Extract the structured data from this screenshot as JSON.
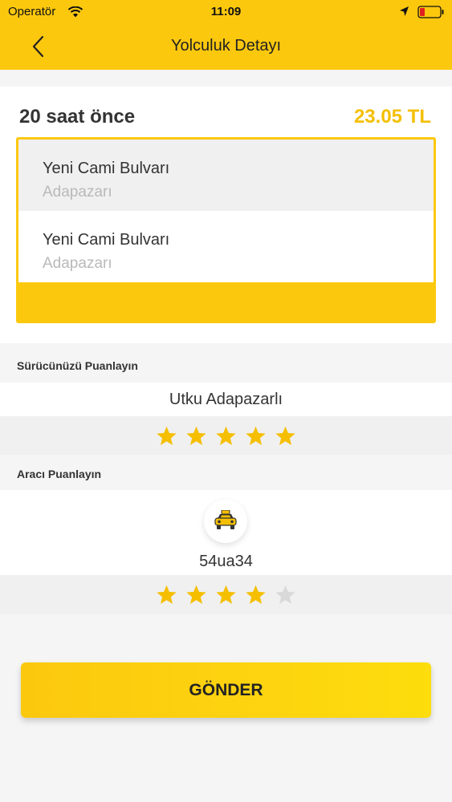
{
  "status_bar": {
    "carrier": "Operatör",
    "time": "11:09"
  },
  "nav": {
    "title": "Yolculuk Detayı"
  },
  "trip": {
    "time_ago": "20 saat önce",
    "price": "23.05 TL",
    "route": [
      {
        "street": "Yeni Cami Bulvarı",
        "city": "Adapazarı"
      },
      {
        "street": "Yeni Cami Bulvarı",
        "city": "Adapazarı"
      }
    ]
  },
  "driver_rating": {
    "section_title": "Sürücünüzü Puanlayın",
    "driver_name": "Utku Adapazarlı",
    "rating": 5,
    "max_rating": 5
  },
  "vehicle_rating": {
    "section_title": "Aracı Puanlayın",
    "plate": "54ua34",
    "rating": 4,
    "max_rating": 5
  },
  "submit": {
    "label": "GÖNDER"
  },
  "colors": {
    "accent": "#fcc80e",
    "price": "#f5bf00",
    "star_on": "#f5bf00",
    "star_off": "#d9d9d9"
  }
}
